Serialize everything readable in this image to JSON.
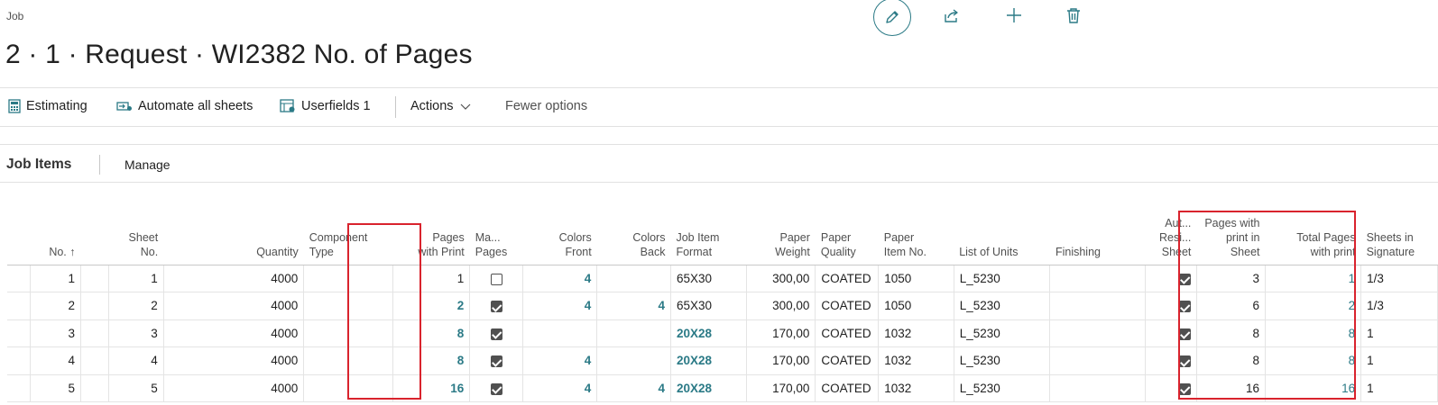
{
  "page": {
    "caption": "Job",
    "title": "2 · 1 · Request · WI2382 No. of Pages"
  },
  "top_actions": {
    "edit": "pencil-icon",
    "share": "share-icon",
    "new": "plus-icon",
    "delete": "trash-icon"
  },
  "action_bar": {
    "estimating": "Estimating",
    "automate": "Automate all sheets",
    "userfields": "Userfields 1",
    "actions": "Actions",
    "fewer": "Fewer options"
  },
  "part": {
    "title": "Job Items",
    "manage": "Manage"
  },
  "table": {
    "headers": {
      "no": "No. ↑",
      "sheet_no_1": "Sheet",
      "sheet_no_2": "No.",
      "quantity": "Quantity",
      "component_1": "Component",
      "component_2": "Type",
      "pages_wp_1": "Pages",
      "pages_wp_2": "with Print",
      "manual_1": "Ma...",
      "manual_2": "Pages",
      "cf_1": "Colors",
      "cf_2": "Front",
      "cb_1": "Colors",
      "cb_2": "Back",
      "fmt_1": "Job Item",
      "fmt_2": "Format",
      "pw_1": "Paper",
      "pw_2": "Weight",
      "pq_1": "Paper",
      "pq_2": "Quality",
      "pi_1": "Paper",
      "pi_2": "Item No.",
      "units": "List of Units",
      "finishing": "Finishing",
      "auto_1": "Aut...",
      "auto_2": "Resi...",
      "auto_3": "Sheet",
      "pps_1": "Pages with",
      "pps_2": "print in",
      "pps_3": "Sheet",
      "tp_1": "Total Pages",
      "tp_2": "with print",
      "sig_1": "Sheets in",
      "sig_2": "Signature"
    },
    "rows": [
      {
        "no": "1",
        "sheet": "1",
        "qty": "4000",
        "pages": "1",
        "manual": false,
        "cf": "4",
        "cb": "",
        "fmt": "65X30",
        "pw": "300,00",
        "pq": "COATED",
        "pi": "1050",
        "units": "L_5230",
        "auto": true,
        "pps": "3",
        "tp": "1",
        "sig": "1/3"
      },
      {
        "no": "2",
        "sheet": "2",
        "qty": "4000",
        "pages": "2",
        "manual": true,
        "cf": "4",
        "cb": "4",
        "fmt": "65X30",
        "pw": "300,00",
        "pq": "COATED",
        "pi": "1050",
        "units": "L_5230",
        "auto": true,
        "pps": "6",
        "tp": "2",
        "sig": "1/3"
      },
      {
        "no": "3",
        "sheet": "3",
        "qty": "4000",
        "pages": "8",
        "manual": true,
        "cf": "",
        "cb": "",
        "fmt": "20X28",
        "pw": "170,00",
        "pq": "COATED",
        "pi": "1032",
        "units": "L_5230",
        "auto": true,
        "pps": "8",
        "tp": "8",
        "sig": "1"
      },
      {
        "no": "4",
        "sheet": "4",
        "qty": "4000",
        "pages": "8",
        "manual": true,
        "cf": "4",
        "cb": "",
        "fmt": "20X28",
        "pw": "170,00",
        "pq": "COATED",
        "pi": "1032",
        "units": "L_5230",
        "auto": true,
        "pps": "8",
        "tp": "8",
        "sig": "1"
      },
      {
        "no": "5",
        "sheet": "5",
        "qty": "4000",
        "pages": "16",
        "manual": true,
        "cf": "4",
        "cb": "4",
        "fmt": "20X28",
        "pw": "170,00",
        "pq": "COATED",
        "pi": "1032",
        "units": "L_5230",
        "auto": true,
        "pps": "16",
        "tp": "16",
        "sig": "1"
      }
    ]
  },
  "colors": {
    "accent": "#2b7a86",
    "highlight": "#d9232d"
  }
}
